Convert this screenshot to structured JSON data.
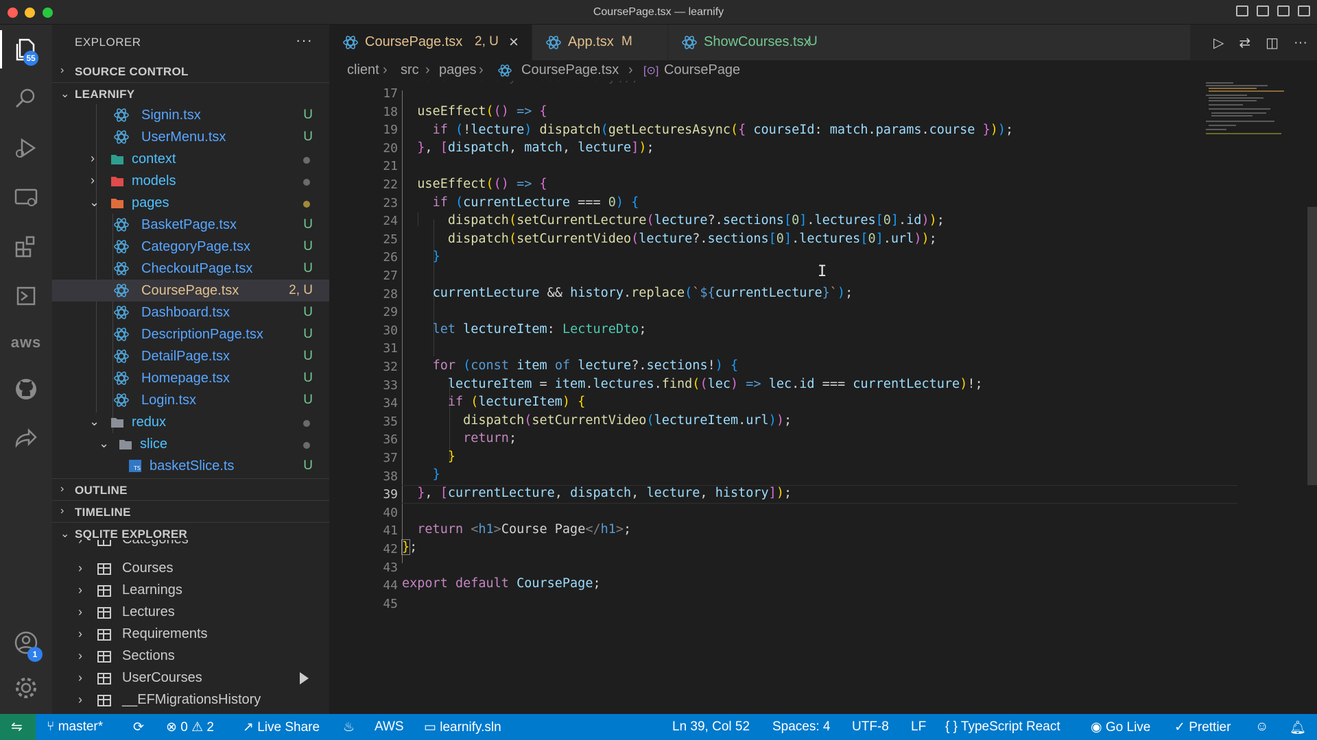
{
  "window": {
    "title": "CoursePage.tsx — learnify"
  },
  "activity": {
    "explorer_badge": "55",
    "account_badge": "1",
    "aws_label": "aws"
  },
  "sidebar": {
    "title": "EXPLORER",
    "more": "···",
    "source_control": "SOURCE CONTROL",
    "project": "LEARNIFY",
    "outline": "OUTLINE",
    "timeline": "TIMELINE",
    "sqlite": "SQLITE EXPLORER",
    "files": [
      {
        "name": "Signin.tsx",
        "status": "U"
      },
      {
        "name": "UserMenu.tsx",
        "status": "U"
      },
      {
        "name": "context",
        "status": ""
      },
      {
        "name": "models",
        "status": ""
      },
      {
        "name": "pages",
        "status": ""
      },
      {
        "name": "BasketPage.tsx",
        "status": "U"
      },
      {
        "name": "CategoryPage.tsx",
        "status": "U"
      },
      {
        "name": "CheckoutPage.tsx",
        "status": "U"
      },
      {
        "name": "CoursePage.tsx",
        "status": "2, U"
      },
      {
        "name": "Dashboard.tsx",
        "status": "U"
      },
      {
        "name": "DescriptionPage.tsx",
        "status": "U"
      },
      {
        "name": "DetailPage.tsx",
        "status": "U"
      },
      {
        "name": "Homepage.tsx",
        "status": "U"
      },
      {
        "name": "Login.tsx",
        "status": "U"
      },
      {
        "name": "redux",
        "status": ""
      },
      {
        "name": "slice",
        "status": ""
      },
      {
        "name": "basketSlice.ts",
        "status": "U"
      }
    ],
    "tables": [
      "Categories",
      "Courses",
      "Learnings",
      "Lectures",
      "Requirements",
      "Sections",
      "UserCourses",
      "__EFMigrationsHistory"
    ]
  },
  "tabs": [
    {
      "name": "CoursePage.tsx",
      "status": "2, U"
    },
    {
      "name": "App.tsx",
      "status": "M"
    },
    {
      "name": "ShowCourses.tsx",
      "status": "U"
    }
  ],
  "breadcrumb": [
    "client",
    "src",
    "pages",
    "CoursePage.tsx",
    "CoursePage"
  ],
  "editor": {
    "line_numbers": [
      "17",
      "18",
      "19",
      "20",
      "21",
      "22",
      "23",
      "24",
      "25",
      "26",
      "27",
      "28",
      "29",
      "30",
      "31",
      "32",
      "33",
      "34",
      "35",
      "36",
      "37",
      "38",
      "39",
      "40",
      "41",
      "42",
      "43",
      "44",
      "45"
    ],
    "current_line": "39"
  },
  "statusbar": {
    "branch": "master*",
    "errors": "0",
    "warnings": "2",
    "live_share": "Live Share",
    "aws": "AWS",
    "solution": "learnify.sln",
    "cursor": "Ln 39, Col 52",
    "spaces": "Spaces: 4",
    "encoding": "UTF-8",
    "eol": "LF",
    "language": "TypeScript React",
    "go_live": "Go Live",
    "prettier": "Prettier"
  }
}
